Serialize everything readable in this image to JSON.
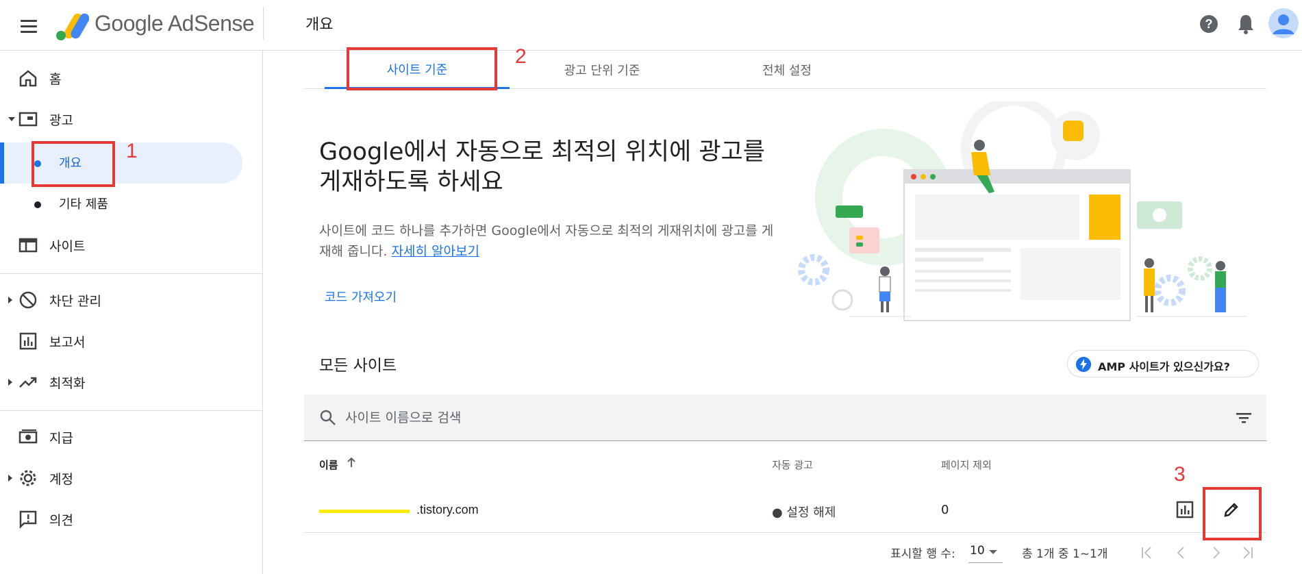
{
  "header": {
    "app_name": "Google AdSense",
    "page_title": "개요"
  },
  "sidebar": {
    "items": [
      {
        "label": "홈",
        "icon": "home-icon"
      },
      {
        "label": "광고",
        "icon": "ads-icon"
      },
      {
        "label": "사이트",
        "icon": "sites-icon"
      },
      {
        "label": "차단 관리",
        "icon": "block-icon"
      },
      {
        "label": "보고서",
        "icon": "report-icon"
      },
      {
        "label": "최적화",
        "icon": "optimize-icon"
      },
      {
        "label": "지급",
        "icon": "payments-icon"
      },
      {
        "label": "계정",
        "icon": "gear-icon"
      },
      {
        "label": "의견",
        "icon": "feedback-icon"
      }
    ],
    "sub_items": [
      {
        "label": "개요",
        "active": true
      },
      {
        "label": "기타 제품",
        "active": false
      }
    ]
  },
  "annotations": [
    "1",
    "2",
    "3"
  ],
  "tabs": [
    {
      "label": "사이트 기준",
      "active": true
    },
    {
      "label": "광고 단위 기준",
      "active": false
    },
    {
      "label": "전체 설정",
      "active": false
    }
  ],
  "hero": {
    "title": "Google에서 자동으로 최적의 위치에 광고를 게재하도록 하세요",
    "description": "사이트에 코드 하나를 추가하면 Google에서 자동으로 최적의 게재위치에 광고를 게재해 줍니다. ",
    "learn_more": "자세히 알아보기",
    "get_code": "코드 가져오기"
  },
  "sites": {
    "title": "모든 사이트",
    "amp_chip": "AMP 사이트가 있으신가요?",
    "search_placeholder": "사이트 이름으로 검색",
    "columns": {
      "name": "이름",
      "auto_ads": "자동 광고",
      "page_exclusions": "페이지 제외"
    },
    "rows": [
      {
        "domain": ".tistory.com",
        "auto_ads": "● 설정 해제",
        "page_exclusions": "0"
      }
    ]
  },
  "pagination": {
    "rows_label": "표시할 행 수:",
    "rows_value": "10",
    "range": "총 1개 중 1~1개"
  },
  "colors": {
    "accent": "#1a73e8",
    "annotation": "#e53935",
    "highlight": "#ffeb00"
  }
}
